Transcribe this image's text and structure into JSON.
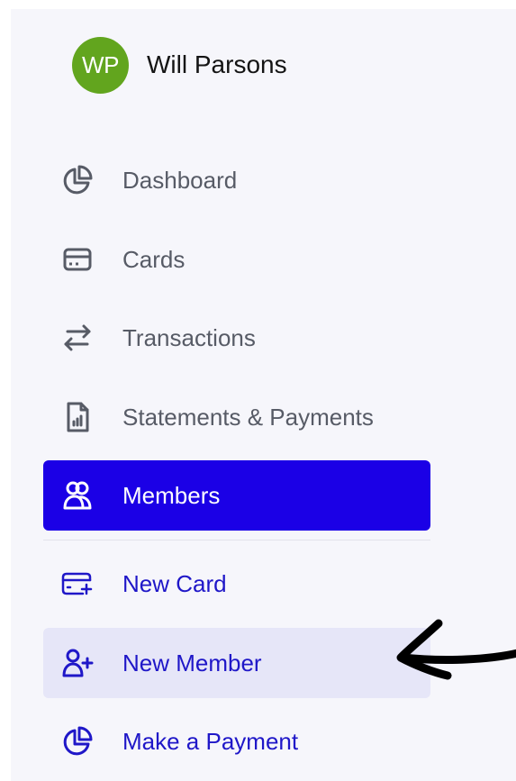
{
  "user": {
    "initials": "WP",
    "name": "Will Parsons",
    "avatar_color": "#62a51e"
  },
  "nav": {
    "primary": [
      {
        "label": "Dashboard",
        "icon": "pie-chart-icon"
      },
      {
        "label": "Cards",
        "icon": "credit-card-icon"
      },
      {
        "label": "Transactions",
        "icon": "transfer-arrows-icon"
      },
      {
        "label": "Statements & Payments",
        "icon": "document-chart-icon"
      },
      {
        "label": "Members",
        "icon": "users-icon",
        "active": true
      }
    ],
    "actions": [
      {
        "label": "New Card",
        "icon": "add-card-icon"
      },
      {
        "label": "New Member",
        "icon": "add-user-icon",
        "highlighted": true
      },
      {
        "label": "Make a Payment",
        "icon": "pie-chart-icon"
      }
    ]
  },
  "colors": {
    "active_bg": "#1b00e6",
    "accent_text": "#1f17c8",
    "muted_text": "#575b66",
    "highlight_bg": "#e6e6f8",
    "sidebar_bg": "#f6f6fb"
  },
  "annotation": {
    "icon": "hand-drawn-arrow-icon",
    "points_to": "New Member"
  }
}
